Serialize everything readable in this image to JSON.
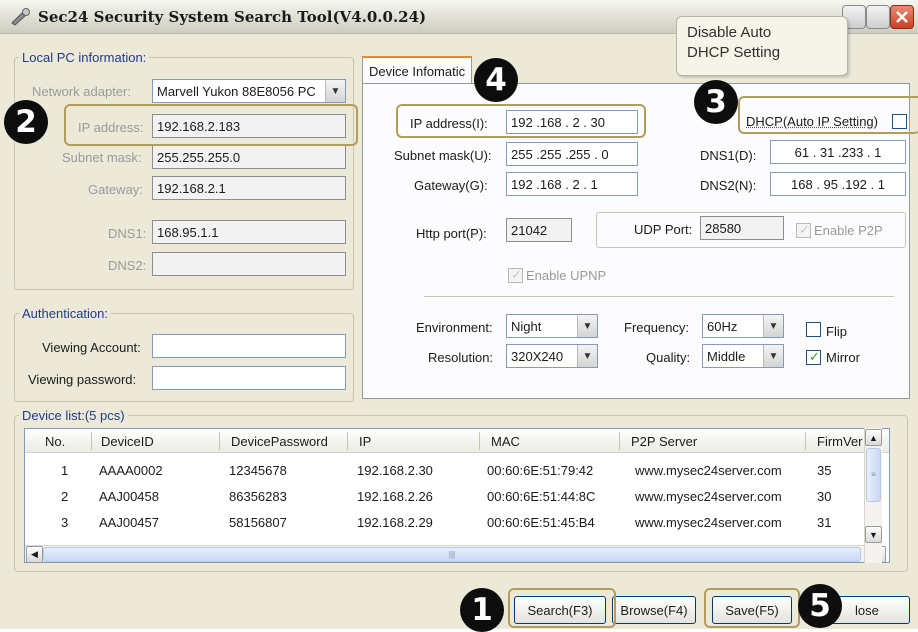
{
  "window": {
    "title": "Sec24 Security System Search Tool(V4.0.0.24)",
    "tooltip": {
      "line1": "Disable Auto",
      "line2": "DHCP Setting"
    }
  },
  "local_pc": {
    "legend": "Local PC information:",
    "adapter_label": "Network adapter:",
    "adapter_value": "Marvell Yukon 88E8056 PC",
    "ip_label": "IP address:",
    "ip_value": "192.168.2.183",
    "mask_label": "Subnet mask:",
    "mask_value": "255.255.255.0",
    "gw_label": "Gateway:",
    "gw_value": "192.168.2.1",
    "dns1_label": "DNS1:",
    "dns1_value": "168.95.1.1",
    "dns2_label": "DNS2:",
    "dns2_value": ""
  },
  "auth": {
    "legend": "Authentication:",
    "account_label": "Viewing Account:",
    "account_value": "",
    "password_label": "Viewing password:",
    "password_value": ""
  },
  "device": {
    "tab_label": "Device Infomatic",
    "ip_label": "IP address(I):",
    "ip_value": "192 .168 . 2  . 30",
    "mask_label": "Subnet mask(U):",
    "mask_value": "255 .255 .255 . 0",
    "gw_label": "Gateway(G):",
    "gw_value": "192 .168 . 2  . 1",
    "dhcp_label": "DHCP(Auto IP Setting)",
    "dhcp_checked": false,
    "dns1_label": "DNS1(D):",
    "dns1_value": "61 . 31 .233 . 1",
    "dns2_label": "DNS2(N):",
    "dns2_value": "168 . 95 .192 . 1",
    "http_label": "Http port(P):",
    "http_value": "21042",
    "udp_label": "UDP Port:",
    "udp_value": "28580",
    "p2p_label": "Enable P2P",
    "upnp_label": "Enable UPNP",
    "env_label": "Environment:",
    "env_value": "Night",
    "freq_label": "Frequency:",
    "freq_value": "60Hz",
    "res_label": "Resolution:",
    "res_value": "320X240",
    "quality_label": "Quality:",
    "quality_value": "Middle",
    "flip_label": "Flip",
    "flip_checked": false,
    "mirror_label": "Mirror",
    "mirror_checked": true
  },
  "device_list": {
    "legend": "Device list:(5 pcs)",
    "headers": [
      "No.",
      "DeviceID",
      "DevicePassword",
      "IP",
      "MAC",
      "P2P Server",
      "FirmVer"
    ],
    "rows": [
      [
        "1",
        "AAAA0002",
        "12345678",
        "192.168.2.30",
        "00:60:6E:51:79:42",
        "www.mysec24server.com",
        "35"
      ],
      [
        "2",
        "AAJ00458",
        "86356283",
        "192.168.2.26",
        "00:60:6E:51:44:8C",
        "www.mysec24server.com",
        "30"
      ],
      [
        "3",
        "AAJ00457",
        "58156807",
        "192.168.2.29",
        "00:60:6E:51:45:B4",
        "www.mysec24server.com",
        "31"
      ]
    ]
  },
  "buttons": {
    "search": "Search(F3)",
    "browse": "Browse(F4)",
    "save": "Save(F5)",
    "close": "lose"
  },
  "markers": [
    "1",
    "2",
    "3",
    "4",
    "5"
  ],
  "colors": {
    "highlight": "#b39d5c",
    "legend": "#1f3c8a",
    "marker_bg": "#0d0d0d"
  }
}
